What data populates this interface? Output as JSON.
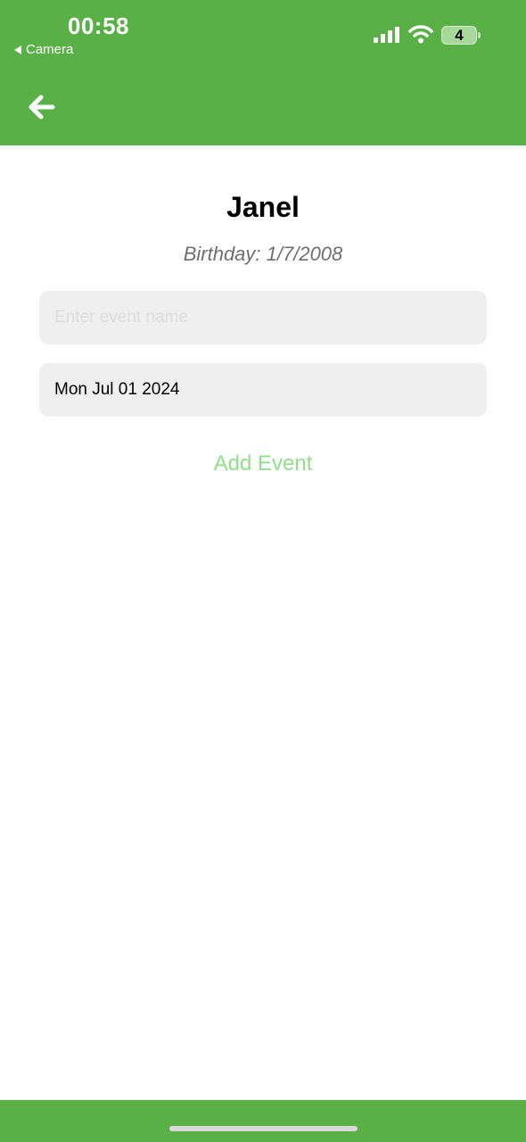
{
  "status_bar": {
    "time": "00:58",
    "back_app_label": "Camera",
    "battery_level": "4",
    "signal_icon": "cellular-signal-icon",
    "wifi_icon": "wifi-icon"
  },
  "nav": {
    "back_icon": "arrow-left-icon"
  },
  "profile": {
    "name": "Janel",
    "birthday": "Birthday: 1/7/2008"
  },
  "form": {
    "event_name": {
      "value": "",
      "placeholder": "Enter event name"
    },
    "date_value": "Mon Jul 01 2024",
    "add_button_label": "Add Event"
  },
  "colors": {
    "header_bg": "#58b047",
    "field_bg": "#efefef",
    "add_button_text": "#8fe08a",
    "subtitle_text": "#6e6e73"
  }
}
